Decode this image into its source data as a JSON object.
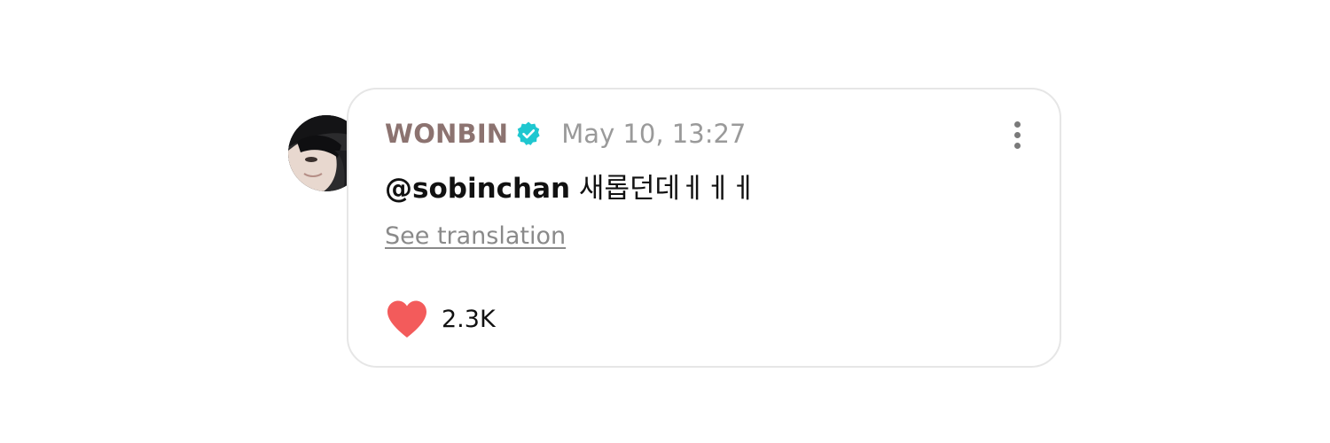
{
  "comment": {
    "username": "WONBIN",
    "timestamp": "May 10, 13:27",
    "mention": "@sobinchan",
    "text": " 새롭던데ㅔㅔㅔ",
    "translate_label": "See translation",
    "like_count": "2.3K",
    "verified": true,
    "liked": true
  },
  "colors": {
    "username": "#8c7370",
    "verified_badge": "#1fc7d0",
    "heart": "#f35b5b",
    "border": "#e6e6e6"
  },
  "icons": {
    "verified": "verified-badge-icon",
    "more": "more-vertical-icon",
    "like": "heart-icon"
  }
}
